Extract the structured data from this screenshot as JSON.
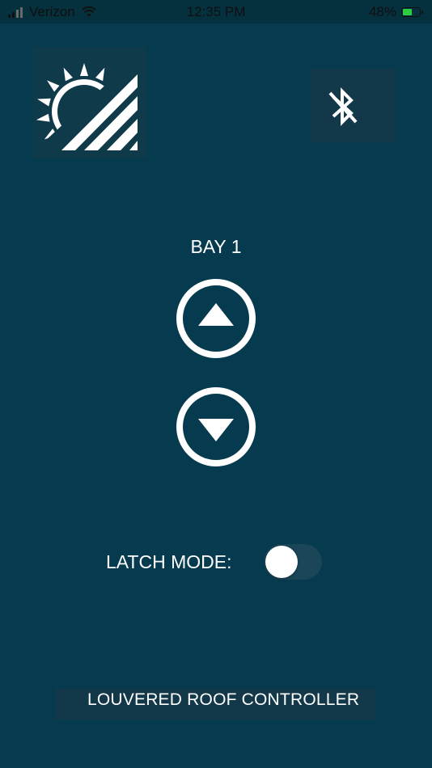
{
  "status_bar": {
    "carrier": "Verizon",
    "time": "12:35 PM",
    "battery_percent": "48%",
    "battery_level": 0.48,
    "signal_icon": "cellular-signal-icon",
    "wifi_icon": "wifi-icon",
    "battery_icon": "battery-charging-icon"
  },
  "header": {
    "logo_icon": "sun-louver-logo-icon",
    "bluetooth_icon": "bluetooth-disabled-icon"
  },
  "control": {
    "bay_label": "BAY 1",
    "up_icon": "arrow-up-circle-icon",
    "down_icon": "arrow-down-circle-icon"
  },
  "latch": {
    "label": "LATCH MODE:",
    "enabled": false
  },
  "footer": {
    "title": "LOUVERED ROOF CONTROLLER"
  },
  "colors": {
    "background": "#063a4e",
    "panel": "#12384a",
    "foreground": "#ffffff",
    "battery_fill": "#2ecc40"
  }
}
